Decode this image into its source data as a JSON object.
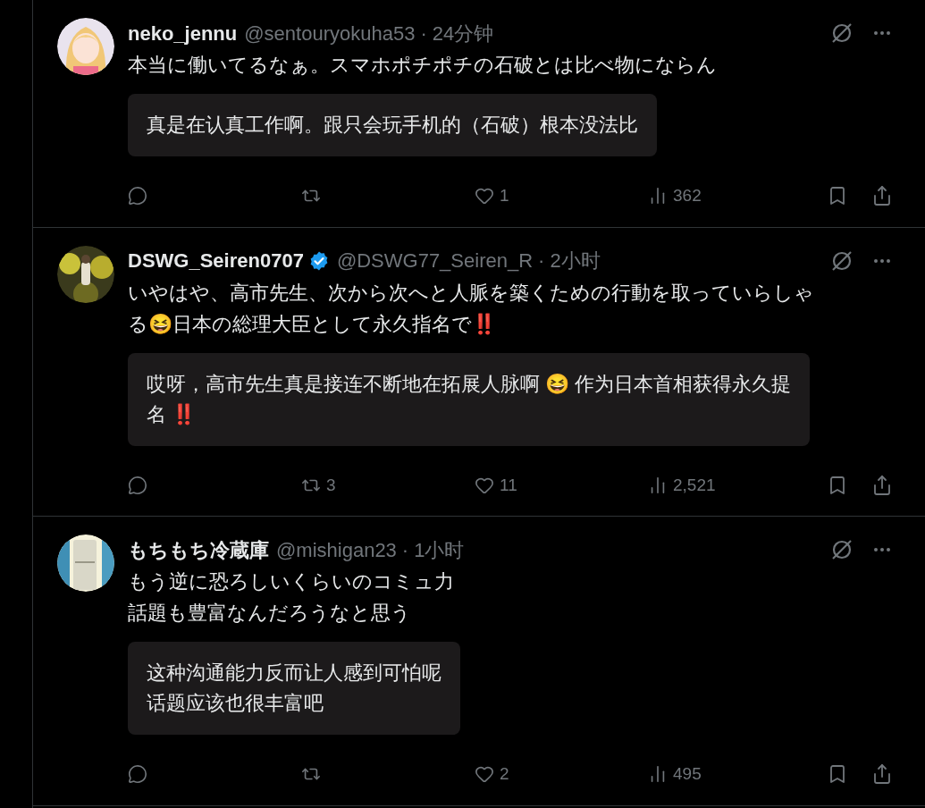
{
  "tweets": [
    {
      "author": {
        "name": "neko_jennu",
        "handle": "@sentouryokuha53",
        "verified": false
      },
      "dot": "·",
      "time": "24分钟",
      "avatar": {
        "kind": "picture"
      },
      "text": [
        "本当に働いてるなぁ。スマホポチポチの石破とは比べ物にならん"
      ],
      "translation": [
        "真是在认真工作啊。跟只会玩手机的（石破）根本没法比"
      ],
      "actions": [
        {
          "kind": "reply"
        },
        {
          "kind": "repost"
        },
        {
          "kind": "like",
          "count": "1"
        },
        {
          "kind": "views",
          "count": "362"
        }
      ]
    },
    {
      "author": {
        "name": "DSWG_Seiren0707",
        "handle": "@DSWG77_Seiren_R",
        "verified": true
      },
      "dot": "·",
      "time": "2小时",
      "avatar": {
        "kind": "picture"
      },
      "text": [
        "いやはや、高市先生、次から次へと人脈を築くための行動を取っていらしゃ",
        "る😆日本の総理大臣として永久指名で‼️"
      ],
      "translation": [
        "哎呀，高市先生真是接连不断地在拓展人脉啊 😆 作为日本首相获得永久提",
        "名 ‼️"
      ],
      "actions": [
        {
          "kind": "reply"
        },
        {
          "kind": "repost",
          "count": "3"
        },
        {
          "kind": "like",
          "count": "11"
        },
        {
          "kind": "views",
          "count": "2,521"
        }
      ]
    },
    {
      "author": {
        "name": "もちもち冷蔵庫",
        "handle": "@mishigan23",
        "verified": false
      },
      "dot": "·",
      "time": "1小时",
      "avatar": {
        "kind": "picture"
      },
      "text": [
        "もう逆に恐ろしいくらいのコミュ力",
        "話題も豊富なんだろうなと思う"
      ],
      "translation": [
        "这种沟通能力反而让人感到可怕呢",
        "话题应该也很丰富吧"
      ],
      "actions": [
        {
          "kind": "reply"
        },
        {
          "kind": "repost"
        },
        {
          "kind": "like",
          "count": "2"
        },
        {
          "kind": "views",
          "count": "495"
        }
      ]
    }
  ]
}
